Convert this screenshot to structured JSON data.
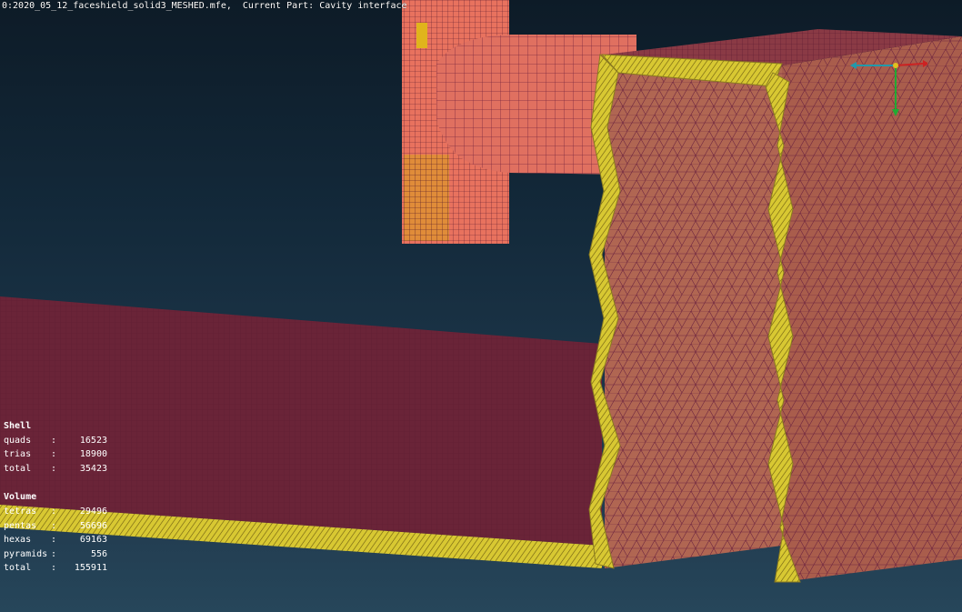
{
  "title": "0:2020_05_12_faceshield_solid3_MESHED.mfe,  Current Part: Cavity interface",
  "stats": {
    "shell": {
      "heading": "Shell",
      "rows": [
        {
          "key": "quads",
          "sep": ":",
          "value": "16523"
        },
        {
          "key": "trias",
          "sep": ":",
          "value": "18900"
        },
        {
          "key": "total",
          "sep": ":",
          "value": "35423"
        }
      ]
    },
    "volume": {
      "heading": "Volume",
      "rows": [
        {
          "key": "tetras",
          "sep": ":",
          "value": "29496"
        },
        {
          "key": "pentas",
          "sep": ":",
          "value": "56696"
        },
        {
          "key": "hexas",
          "sep": ":",
          "value": "69163"
        },
        {
          "key": "pyramids",
          "sep": ":",
          "value": "556"
        },
        {
          "key": "total",
          "sep": ":",
          "value": "155911"
        }
      ]
    }
  },
  "colors": {
    "mesh_salmon": "#e8725e",
    "mesh_dark_block": "#7a2f45",
    "mesh_brown": "#b66a55",
    "interface_yellow": "#d8c832",
    "axis_x": "#cc2222",
    "axis_y": "#22aa33",
    "axis_z": "#2299aa"
  }
}
